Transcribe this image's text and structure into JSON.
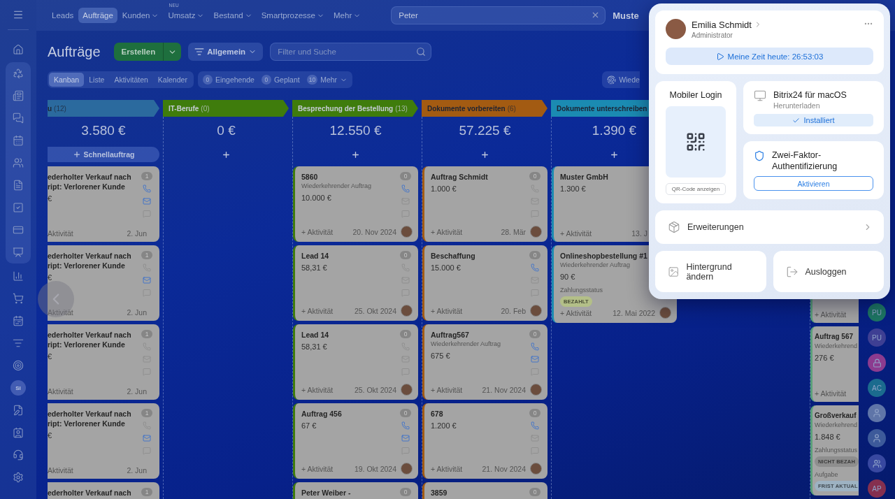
{
  "top_nav": [
    {
      "label": "Leads",
      "selected": false,
      "dropdown": false
    },
    {
      "label": "Aufträge",
      "selected": true,
      "dropdown": false
    },
    {
      "label": "Kunden",
      "selected": false,
      "dropdown": true
    },
    {
      "label": "Umsatz",
      "selected": false,
      "dropdown": true,
      "badge": "NEU"
    },
    {
      "label": "Bestand",
      "selected": false,
      "dropdown": true
    },
    {
      "label": "Smartprozesse",
      "selected": false,
      "dropdown": true
    },
    {
      "label": "Mehr",
      "selected": false,
      "dropdown": true
    }
  ],
  "global_search": {
    "value": "Peter"
  },
  "portal_name": "Muste",
  "sidebar": {
    "avatar_initials": "SI"
  },
  "page": {
    "title": "Aufträge",
    "create_button": "Erstellen",
    "filter_preset": "Allgemein",
    "search": {
      "placeholder": "Filter und Suche"
    }
  },
  "view_tabs": [
    {
      "label": "Kanban",
      "selected": true
    },
    {
      "label": "Liste",
      "selected": false
    },
    {
      "label": "Aktivitäten",
      "selected": false
    },
    {
      "label": "Kalender",
      "selected": false
    }
  ],
  "counters": [
    {
      "count": "0",
      "label": "Eingehende",
      "dropdown": false
    },
    {
      "count": "0",
      "label": "Geplant",
      "dropdown": false
    },
    {
      "count": "10",
      "label": "Mehr",
      "dropdown": true
    }
  ],
  "right_button": "Wiede",
  "columns": [
    {
      "header": {
        "name": "u",
        "count": "(12)"
      },
      "color": "#2b6a9e",
      "sum": "3.580 €",
      "quick_add": "Schnellauftrag",
      "cards": [
        {
          "title": "ederholter Verkauf nach\nript: Verlorener Kunde",
          "amount": "€",
          "activity": "Aktivität",
          "date": "2. Jun",
          "count": "1",
          "phone": true,
          "mail": true,
          "avatar": false
        },
        {
          "title": "ederholter Verkauf nach\nript: Verlorener Kunde",
          "amount": "€",
          "activity": "Aktivität",
          "date": "2. Jun",
          "count": "1",
          "phone": false,
          "mail": true,
          "avatar": false
        },
        {
          "title": "ederholter Verkauf nach\nript: Verlorener Kunde",
          "amount": "€",
          "activity": "Aktivität",
          "date": "2. Jun",
          "count": "1",
          "phone": false,
          "mail": false,
          "avatar": false
        },
        {
          "title": "ederholter Verkauf nach\nript: Verlorener Kunde",
          "amount": "€",
          "activity": "Aktivität",
          "date": "2. Jun",
          "count": "1",
          "phone": false,
          "mail": true,
          "avatar": false
        },
        {
          "title": "ederholter Verkauf nach",
          "count": "1"
        }
      ]
    },
    {
      "header": {
        "name": "IT-Berufe",
        "count": "(0)"
      },
      "color": "#3f7c0c",
      "sum": "0 €"
    },
    {
      "header": {
        "name": "Besprechung der Bestellung",
        "count": "(13)"
      },
      "color": "#3f7c0c",
      "sum": "12.550 €",
      "cards": [
        {
          "title": "5860",
          "subtitle": "Wiederkehrender Auftrag",
          "amount": "10.000 €",
          "activity": "+ Aktivität",
          "date": "20. Nov 2024",
          "count": "0",
          "phone": true,
          "mail": false,
          "avatar": true
        },
        {
          "title": "Lead 14",
          "amount": "58,31 €",
          "activity": "+ Aktivität",
          "date": "25. Okt 2024",
          "count": "0",
          "phone": false,
          "mail": false,
          "avatar": true
        },
        {
          "title": "Lead 14",
          "amount": "58,31 €",
          "activity": "+ Aktivität",
          "date": "25. Okt 2024",
          "count": "0",
          "phone": false,
          "mail": false,
          "avatar": true
        },
        {
          "title": "Auftrag 456",
          "amount": "67 €",
          "activity": "+ Aktivität",
          "date": "19. Okt 2024",
          "count": "0",
          "phone": true,
          "mail": true,
          "avatar": true
        },
        {
          "title": "Peter Weiber -",
          "count": "0"
        }
      ]
    },
    {
      "header": {
        "name": "Dokumente vorbereiten",
        "count": "(6)"
      },
      "color": "#a35b12",
      "sum": "57.225 €",
      "cards": [
        {
          "title": "Auftrag Schmidt",
          "amount": "1.000 €",
          "activity": "+ Aktivität",
          "date": "28. Mär",
          "count": "0",
          "phone": false,
          "mail": false,
          "avatar": true
        },
        {
          "title": "Beschaffung",
          "amount": "15.000 €",
          "activity": "+ Aktivität",
          "date": "20. Feb",
          "count": "0",
          "phone": true,
          "mail": false,
          "avatar": true
        },
        {
          "title": "Auftrag567",
          "subtitle": "Wiederkehrender Auftrag",
          "amount": "675 €",
          "activity": "+ Aktivität",
          "date": "21. Nov 2024",
          "count": "0",
          "phone": true,
          "mail": true,
          "avatar": true
        },
        {
          "title": "678",
          "amount": "1.200 €",
          "activity": "+ Aktivität",
          "date": "21. Nov 2024",
          "count": "0",
          "phone": true,
          "mail": false,
          "avatar": true
        },
        {
          "title": "3859",
          "count": "0"
        }
      ]
    },
    {
      "header": {
        "name": "Dokumente unterschreiben"
      },
      "color": "#1b8bb2",
      "sum": "1.390 €",
      "cards": [
        {
          "title": "Muster GmbH",
          "amount": "1.300 €",
          "activity": "+ Aktivität",
          "date": "13. J"
        },
        {
          "title": "Onlineshopbestellung #1",
          "subtitle": "Wiederkehrender Auftrag",
          "amount": "90 €",
          "tags": [
            {
              "label": "Zahlungsstatus",
              "badge": "BEZAHLT",
              "color": "#b3bf88"
            }
          ],
          "activity": "+ Aktivität",
          "date": "12. Mai 2022",
          "avatar": true
        }
      ]
    },
    {
      "color": "#5aa07a",
      "cards": [
        {
          "activity": "+ Aktivität"
        },
        {
          "title": "Auftrag 567",
          "subtitle": "Wiederkehrend",
          "amount": "276 €",
          "activity": "+ Aktivität"
        },
        {
          "title": "Großverkauf",
          "subtitle": "Wiederkehrend",
          "amount": "1.848 €",
          "tags": [
            {
              "label": "Zahlungsstatus",
              "badge": "NICHT BEZAH",
              "color": "#8e8e8e"
            },
            {
              "label": "Aufgabe",
              "badge": "FRIST AKTUAL",
              "color": "#9db2c2"
            }
          ]
        }
      ]
    }
  ],
  "right_rail": [
    {
      "kind": "initials",
      "text": "PU",
      "color": "#1d7563"
    },
    {
      "kind": "initials",
      "text": "PU",
      "color": "#3e3f93"
    },
    {
      "kind": "lock",
      "color": "#8c3b8f"
    },
    {
      "kind": "initials",
      "text": "AC",
      "color": "#1b6b8e"
    },
    {
      "kind": "photo",
      "color": "#5f75a8"
    },
    {
      "kind": "photo",
      "color": "#3d5a9a"
    },
    {
      "kind": "group",
      "color": "#3848a0"
    },
    {
      "kind": "initials",
      "text": "AP",
      "color": "#85304f"
    }
  ],
  "profile_popup": {
    "user": {
      "name": "Emilia Schmidt",
      "role": "Administrator"
    },
    "timer": "Meine Zeit heute: 26:53:03",
    "mobile_login": {
      "title": "Mobiler Login",
      "button": "QR-Code anzeigen"
    },
    "desktop_app": {
      "title": "Bitrix24 für macOS",
      "subtitle": "Herunterladen",
      "status": "Installiert"
    },
    "two_factor": {
      "title": "Zwei-Faktor-Authentifizierung",
      "button": "Aktivieren"
    },
    "extensions": "Erweiterungen",
    "background": "Hintergrund ändern",
    "logout": "Ausloggen"
  }
}
